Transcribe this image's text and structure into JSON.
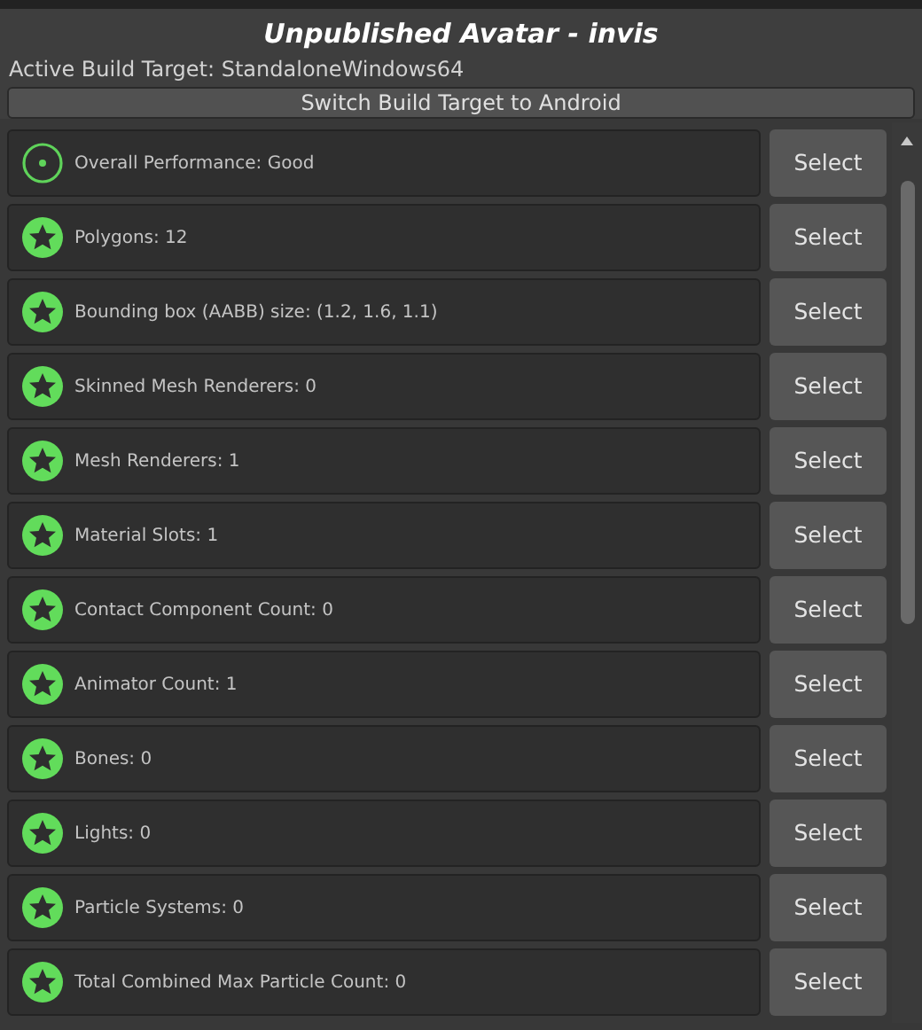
{
  "title": "Unpublished Avatar - invis",
  "build_target": "Active Build Target: StandaloneWindows64",
  "switch_button": "Switch Build Target to Android",
  "stats": [
    {
      "kind": "ring",
      "label": "Overall Performance: Good",
      "button": "Select"
    },
    {
      "kind": "star",
      "label": "Polygons: 12",
      "button": "Select"
    },
    {
      "kind": "star",
      "label": "Bounding box (AABB) size: (1.2, 1.6, 1.1)",
      "button": "Select"
    },
    {
      "kind": "star",
      "label": "Skinned Mesh Renderers: 0",
      "button": "Select"
    },
    {
      "kind": "star",
      "label": "Mesh Renderers: 1",
      "button": "Select"
    },
    {
      "kind": "star",
      "label": "Material Slots: 1",
      "button": "Select"
    },
    {
      "kind": "star",
      "label": "Contact Component Count: 0",
      "button": "Select"
    },
    {
      "kind": "star",
      "label": "Animator Count: 1",
      "button": "Select"
    },
    {
      "kind": "star",
      "label": "Bones: 0",
      "button": "Select"
    },
    {
      "kind": "star",
      "label": "Lights: 0",
      "button": "Select"
    },
    {
      "kind": "star",
      "label": "Particle Systems: 0",
      "button": "Select"
    },
    {
      "kind": "star",
      "label": "Total Combined Max Particle Count: 0",
      "button": "Select"
    }
  ]
}
